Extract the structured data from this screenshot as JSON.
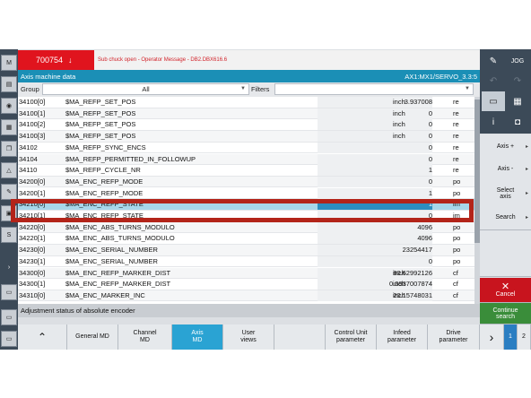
{
  "alarm": {
    "number": "700754",
    "message": "Sub chuck open - Operator Message - DB2.DBX616.6"
  },
  "title": {
    "left": "Axis machine data",
    "right": "AX1:MX1/SERVO_3.3:5"
  },
  "filter": {
    "group_label": "Group",
    "group_value": "All",
    "filters_label": "Filters"
  },
  "rows": [
    {
      "id": "34100[0]",
      "name": "$MA_REFP_SET_POS",
      "value": "3.937008",
      "unit": "inch",
      "level": "re"
    },
    {
      "id": "34100[1]",
      "name": "$MA_REFP_SET_POS",
      "value": "0",
      "unit": "inch",
      "level": "re"
    },
    {
      "id": "34100[2]",
      "name": "$MA_REFP_SET_POS",
      "value": "0",
      "unit": "inch",
      "level": "re"
    },
    {
      "id": "34100[3]",
      "name": "$MA_REFP_SET_POS",
      "value": "0",
      "unit": "inch",
      "level": "re"
    },
    {
      "id": "34102",
      "name": "$MA_REFP_SYNC_ENCS",
      "value": "0",
      "unit": "",
      "level": "re"
    },
    {
      "id": "34104",
      "name": "$MA_REFP_PERMITTED_IN_FOLLOWUP",
      "value": "0",
      "unit": "",
      "level": "re"
    },
    {
      "id": "34110",
      "name": "$MA_REFP_CYCLE_NR",
      "value": "1",
      "unit": "",
      "level": "re"
    },
    {
      "id": "34200[0]",
      "name": "$MA_ENC_REFP_MODE",
      "value": "0",
      "unit": "",
      "level": "po"
    },
    {
      "id": "34200[1]",
      "name": "$MA_ENC_REFP_MODE",
      "value": "1",
      "unit": "",
      "level": "po"
    },
    {
      "id": "34210[0]",
      "name": "$MA_ENC_REFP_STATE",
      "value": "1",
      "unit": "",
      "level": "im"
    },
    {
      "id": "34210[1]",
      "name": "$MA_ENC_REFP_STATE",
      "value": "0",
      "unit": "",
      "level": "im"
    },
    {
      "id": "34220[0]",
      "name": "$MA_ENC_ABS_TURNS_MODULO",
      "value": "4096",
      "unit": "",
      "level": "po"
    },
    {
      "id": "34220[1]",
      "name": "$MA_ENC_ABS_TURNS_MODULO",
      "value": "4096",
      "unit": "",
      "level": "po"
    },
    {
      "id": "34230[0]",
      "name": "$MA_ENC_SERIAL_NUMBER",
      "value": "23254417",
      "unit": "",
      "level": "po"
    },
    {
      "id": "34230[1]",
      "name": "$MA_ENC_SERIAL_NUMBER",
      "value": "0",
      "unit": "",
      "level": "po"
    },
    {
      "id": "34300[0]",
      "name": "$MA_ENC_REFP_MARKER_DIST",
      "value": "80.62992126",
      "unit": "inch",
      "level": "cf"
    },
    {
      "id": "34300[1]",
      "name": "$MA_ENC_REFP_MARKER_DIST",
      "value": "0.3937007874",
      "unit": "inch",
      "level": "cf"
    },
    {
      "id": "34310[0]",
      "name": "$MA_ENC_MARKER_INC",
      "value": "20.15748031",
      "unit": "inch",
      "level": "cf"
    }
  ],
  "status_text": "Adjustment status of absolute encoder",
  "right_buttons": {
    "axis_plus": "Axis +",
    "axis_minus": "Axis -",
    "select_axis": "Select axis",
    "search": "Search",
    "cancel": "Cancel",
    "continue_search": "Continue search"
  },
  "bottom": {
    "general_md": "General MD",
    "channel_md": "Channel MD",
    "axis_md": "Axis MD",
    "user_views": "User views",
    "control_unit": "Control Unit parameter",
    "infeed": "Infeed parameter",
    "drive": "Drive parameter",
    "page1": "1",
    "page2": "2"
  },
  "colors": {
    "alarm": "#e0141e",
    "title": "#1b8fb6",
    "highlight_box": "#b32419",
    "active_tab": "#2aa3d3",
    "cancel": "#c8141e",
    "continue": "#3a8d3a"
  }
}
